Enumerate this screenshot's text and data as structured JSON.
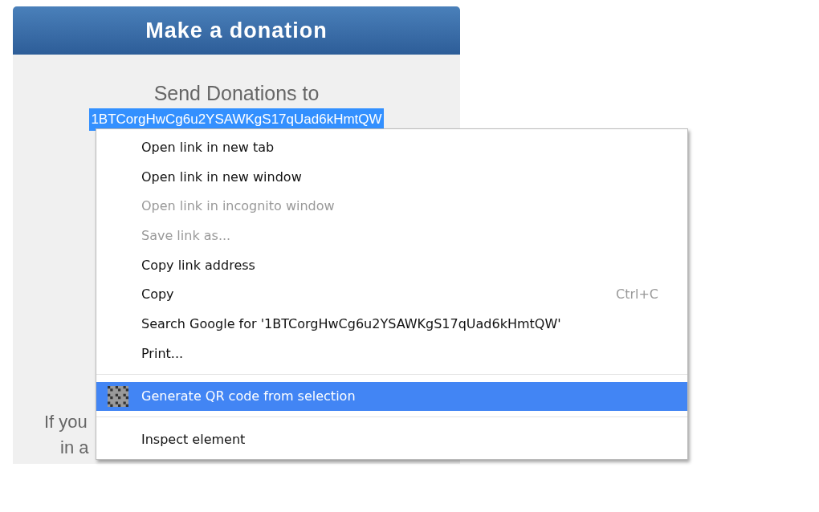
{
  "card": {
    "title": "Make a donation",
    "heading": "Send Donations to",
    "address": "1BTCorgHwCg6u2YSAWKgS17qUad6kHmtQW",
    "address_selected": true,
    "text_lines": [
      "If you",
      "in a"
    ]
  },
  "context_menu": {
    "items": [
      {
        "kind": "item",
        "label": "Open link in new tab",
        "disabled": false,
        "selected": false
      },
      {
        "kind": "item",
        "label": "Open link in new window",
        "disabled": false,
        "selected": false
      },
      {
        "kind": "item",
        "label": "Open link in incognito window",
        "disabled": true,
        "selected": false
      },
      {
        "kind": "item",
        "label": "Save link as...",
        "disabled": true,
        "selected": false
      },
      {
        "kind": "item",
        "label": "Copy link address",
        "disabled": false,
        "selected": false
      },
      {
        "kind": "item",
        "label": "Copy",
        "shortcut": "Ctrl+C",
        "disabled": false,
        "selected": false
      },
      {
        "kind": "item",
        "label": "Search Google for '1BTCorgHwCg6u2YSAWKgS17qUad6kHmtQW'",
        "disabled": false,
        "selected": false
      },
      {
        "kind": "item",
        "label": "Print...",
        "disabled": false,
        "selected": false
      },
      {
        "kind": "separator"
      },
      {
        "kind": "qr-item",
        "label": "Generate QR code from selection",
        "disabled": false,
        "selected": true
      },
      {
        "kind": "separator"
      },
      {
        "kind": "item",
        "label": "Inspect element",
        "disabled": false,
        "selected": false
      }
    ]
  }
}
